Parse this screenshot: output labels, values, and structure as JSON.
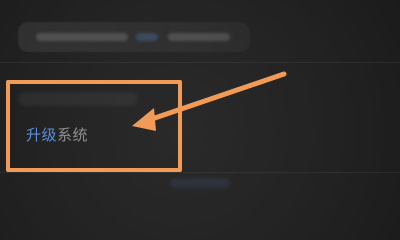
{
  "annotation": {
    "color": "#f29b57"
  },
  "settings": {
    "upgrade_item": {
      "label_part1": "升级",
      "label_part2": "系统",
      "accent_color": "#5a8edb",
      "text_color": "#8f8f8f"
    }
  },
  "icons": {
    "annotation_arrow": "arrow-icon"
  }
}
